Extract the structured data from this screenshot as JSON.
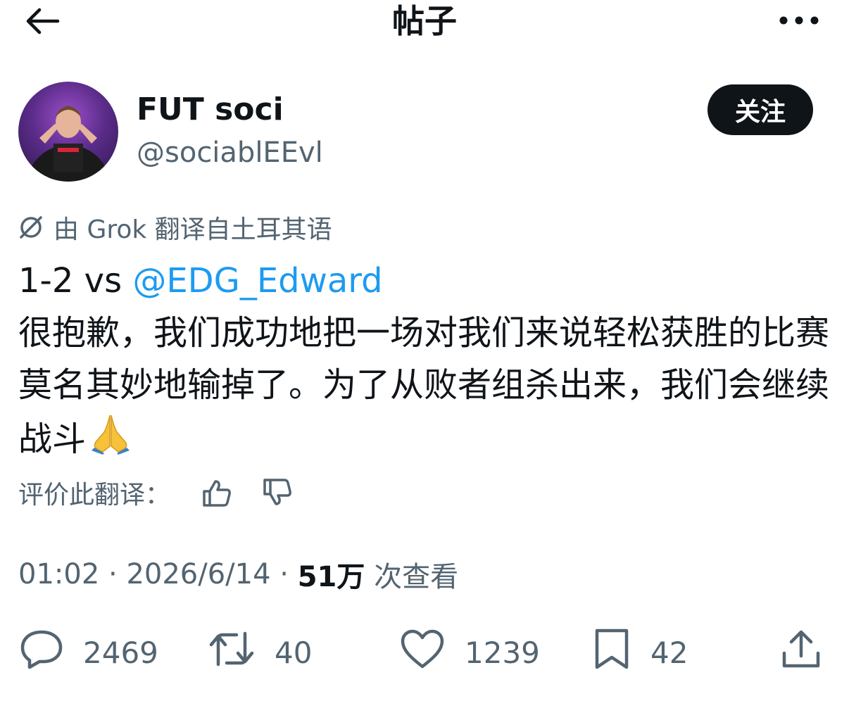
{
  "header": {
    "title": "帖子"
  },
  "author": {
    "display_name": "FUT soci",
    "handle": "@sociablEEvl",
    "follow_label": "关注"
  },
  "translation": {
    "label": "由 Grok 翻译自土耳其语",
    "rate_label": "评价此翻译："
  },
  "tweet": {
    "score_prefix": "1-2 vs ",
    "mention": "@EDG_Edward",
    "text": "很抱歉，我们成功地把一场对我们来说轻松获胜的比赛莫名其妙地输掉了。为了从败者组杀出来，我们会继续战斗"
  },
  "meta": {
    "time": "01:02",
    "date": "2026/6/14",
    "separator": " · ",
    "views_count": "51万",
    "views_label": " 次查看"
  },
  "actions": {
    "replies": "2469",
    "reposts": "40",
    "likes": "1239",
    "bookmarks": "42"
  },
  "icons": {
    "back": "arrow-left-icon",
    "more": "more-horizontal-icon",
    "grok": "grok-icon",
    "thumbs_up": "thumbs-up-icon",
    "thumbs_down": "thumbs-down-icon",
    "reply": "reply-icon",
    "retweet": "retweet-icon",
    "like": "heart-icon",
    "bookmark": "bookmark-icon",
    "share": "share-icon",
    "emoji": "folded-hands-emoji"
  },
  "colors": {
    "text": "#0f1419",
    "secondary": "#536471",
    "link": "#1d9bf0",
    "follow_bg": "#0f1419",
    "follow_text": "#ffffff"
  }
}
